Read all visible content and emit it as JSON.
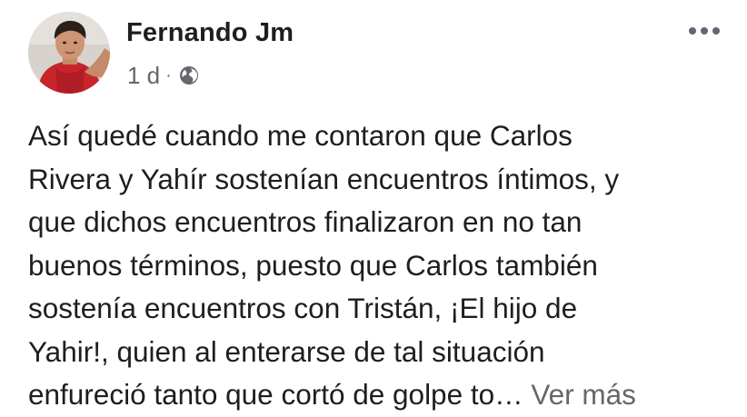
{
  "post": {
    "author": "Fernando Jm",
    "time": "1 d",
    "separator": "·",
    "privacy_icon": "globe-icon",
    "more_icon": "ellipsis-icon",
    "body_lines": [
      "Así quedé cuando me contaron que Carlos",
      "Rivera y Yahír sostenían encuentros íntimos, y",
      "que dichos encuentros finalizaron en no tan",
      "buenos términos, puesto que Carlos también",
      "sostenía encuentros con Tristán, ¡El hijo de",
      "Yahir!, quien al enterarse de tal situación",
      "enfureció tanto que cortó de golpe to…"
    ],
    "see_more": "Ver más"
  },
  "colors": {
    "text_primary": "#1c1e21",
    "text_secondary": "#65676b",
    "background": "#ffffff"
  }
}
